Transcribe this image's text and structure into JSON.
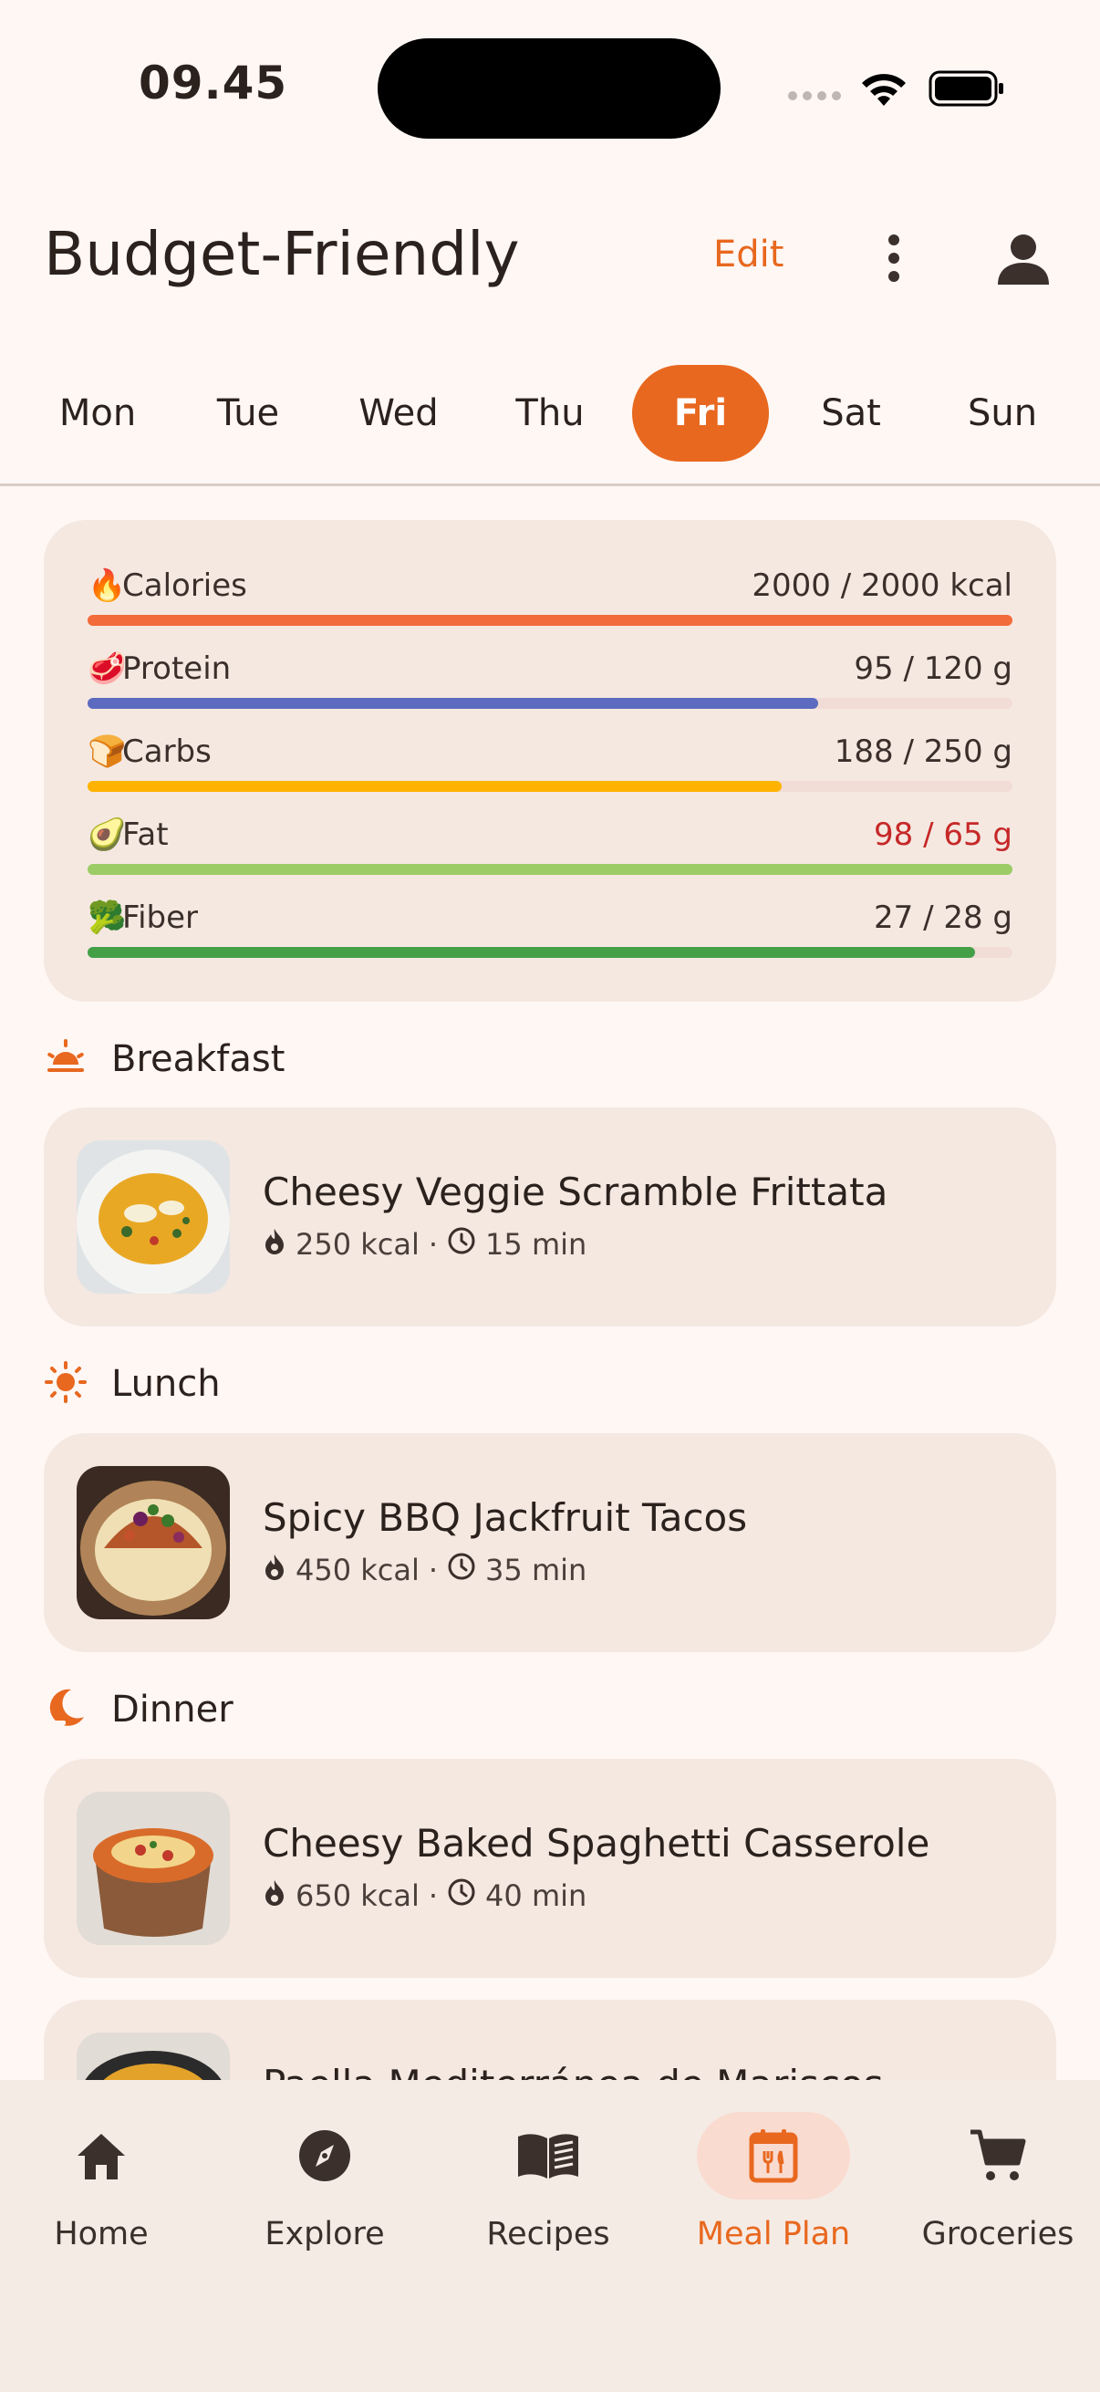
{
  "status_bar": {
    "time": "09.45"
  },
  "header": {
    "title": "Budget-Friendly",
    "edit_label": "Edit"
  },
  "days": [
    {
      "label": "Mon",
      "active": false
    },
    {
      "label": "Tue",
      "active": false
    },
    {
      "label": "Wed",
      "active": false
    },
    {
      "label": "Thu",
      "active": false
    },
    {
      "label": "Fri",
      "active": true
    },
    {
      "label": "Sat",
      "active": false
    },
    {
      "label": "Sun",
      "active": false
    }
  ],
  "nutrition": [
    {
      "emoji": "🔥",
      "label": "Calories",
      "value": "2000 / 2000 kcal",
      "progress": 1.0,
      "color": "#f26b3a",
      "over": false
    },
    {
      "emoji": "🥩",
      "label": "Protein",
      "value": "95 / 120 g",
      "progress": 0.79,
      "color": "#5c6bc0",
      "over": false
    },
    {
      "emoji": "🍞",
      "label": "Carbs",
      "value": "188 / 250 g",
      "progress": 0.75,
      "color": "#ffb300",
      "over": false
    },
    {
      "emoji": "🥑",
      "label": "Fat",
      "value": "98 / 65 g",
      "progress": 1.0,
      "color": "#9ccc65",
      "over": true,
      "over_color": "#c62828"
    },
    {
      "emoji": "🥦",
      "label": "Fiber",
      "value": "27 / 28 g",
      "progress": 0.96,
      "color": "#43a047",
      "over": false
    }
  ],
  "meals": {
    "breakfast": {
      "label": "Breakfast",
      "name": "Cheesy Veggie Scramble Frittata",
      "kcal": "250 kcal",
      "time": "15 min"
    },
    "lunch": {
      "label": "Lunch",
      "name": "Spicy BBQ Jackfruit Tacos",
      "kcal": "450 kcal",
      "time": "35 min"
    },
    "dinner": {
      "label": "Dinner",
      "name": "Cheesy Baked Spaghetti Casserole",
      "kcal": "650 kcal",
      "time": "40 min"
    },
    "extra": {
      "name": "Paella Mediterránea de Mariscos"
    }
  },
  "meta_separator": "·",
  "nav": [
    {
      "label": "Home",
      "icon": "home-icon",
      "active": false
    },
    {
      "label": "Explore",
      "icon": "compass-icon",
      "active": false
    },
    {
      "label": "Recipes",
      "icon": "book-icon",
      "active": false
    },
    {
      "label": "Meal Plan",
      "icon": "calendar-cutlery-icon",
      "active": true
    },
    {
      "label": "Groceries",
      "icon": "cart-icon",
      "active": false
    }
  ],
  "colors": {
    "accent": "#e8681f",
    "background": "#fff7f4",
    "card": "#f5e8e1"
  }
}
